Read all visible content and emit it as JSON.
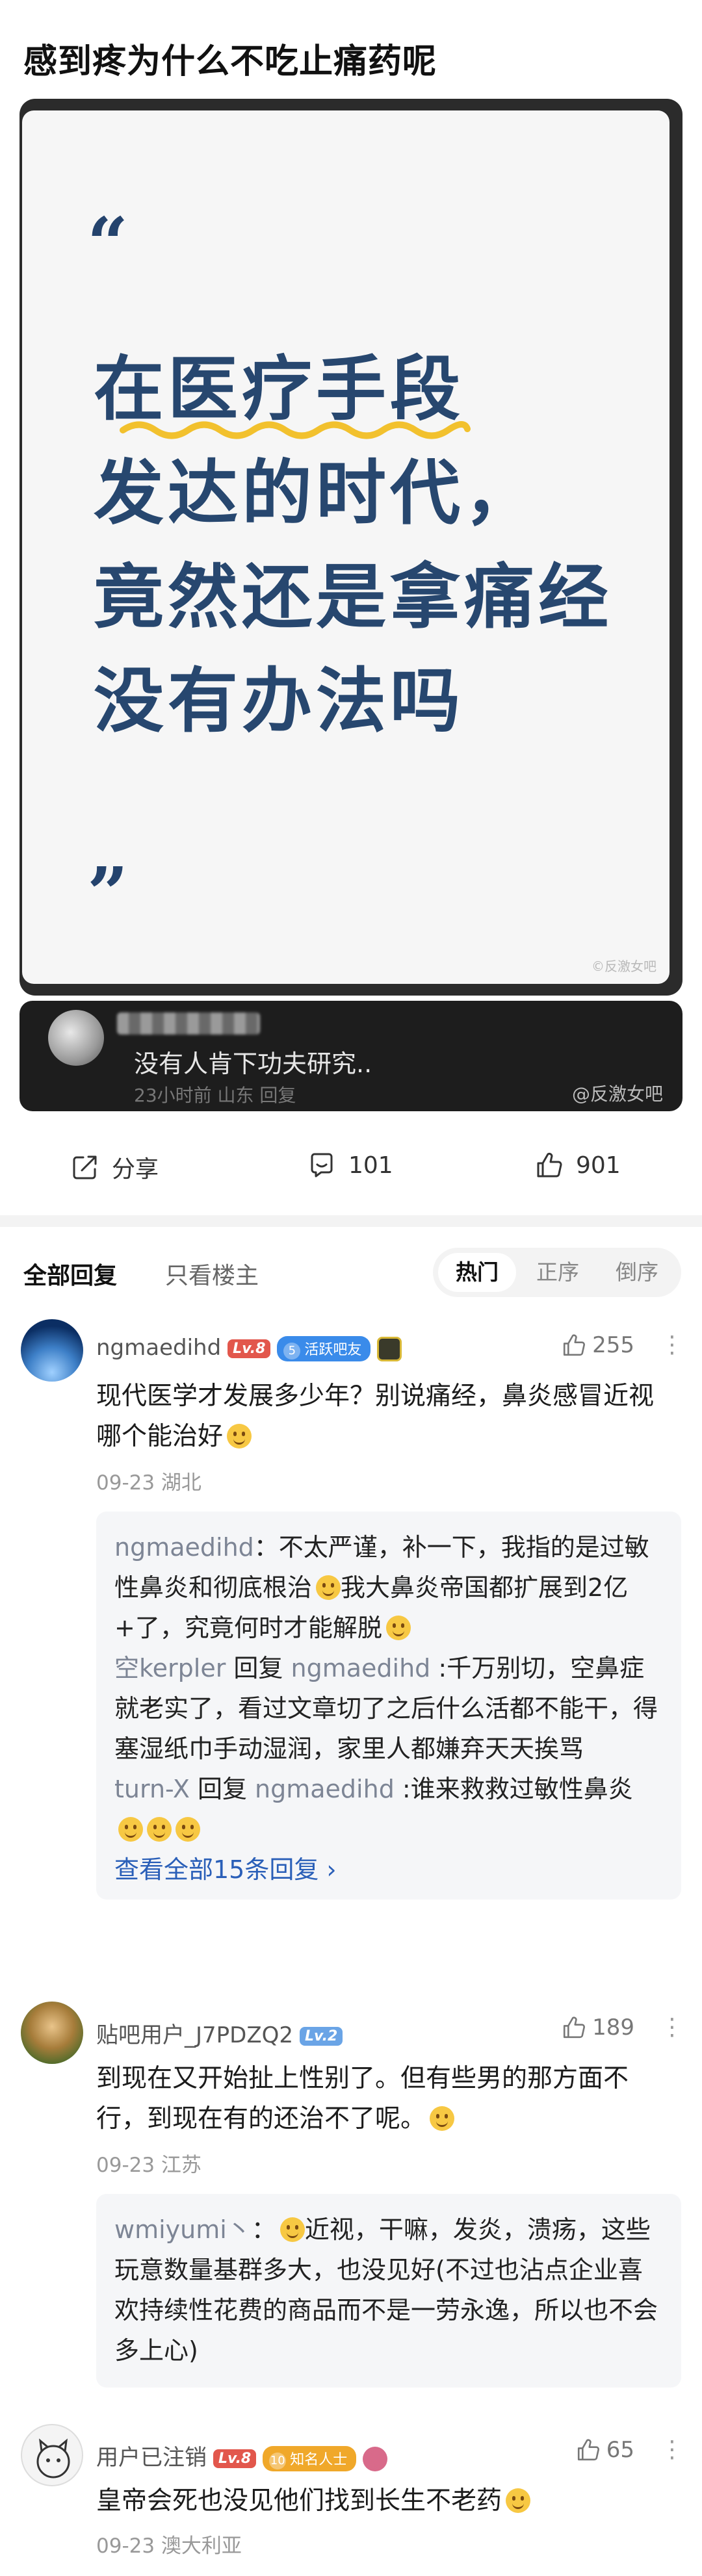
{
  "post": {
    "title": "感到疼为什么不吃止痛药呢",
    "image": {
      "quote_open": "“",
      "quote_close": "”",
      "lines": [
        "在医疗手段",
        "发达的时代，",
        "竟然还是拿痛经",
        "没有办法吗"
      ],
      "watermark": "©反激女吧"
    },
    "quoted_comment": {
      "text": "没有人肯下功夫研究..",
      "meta": "23小时前  山东  回复",
      "watermark": "@反激女吧"
    }
  },
  "actions": {
    "share_label": "分享",
    "comments_count": "101",
    "likes_count": "901"
  },
  "tabs": {
    "all_replies": "全部回复",
    "only_op": "只看楼主",
    "sort_options": [
      "热门",
      "正序",
      "倒序"
    ],
    "active_sort": "热门"
  },
  "comments": [
    {
      "username": "ngmaedihd",
      "level": "Lv.8",
      "badge_num": "5",
      "badge": "活跃吧友",
      "likes": "255",
      "text": "现代医学才发展多少年？别说痛经，鼻炎感冒近视哪个能治好",
      "meta": "09-23  湖北",
      "replies": [
        {
          "name": "ngmaedihd",
          "sep": "：",
          "text": "不太严谨，补一下，我指的是过敏性鼻炎和彻底根治",
          "text2": "我大鼻炎帝国都扩展到2亿+了，究竟何时才能解脱"
        },
        {
          "name": "空kerpler",
          "reply_word": " 回复 ",
          "target": "ngmaedihd",
          "sep": " :",
          "text": "千万别切，空鼻症就老实了，看过文章切了之后什么活都不能干，得塞湿纸巾手动湿润，家里人都嫌弃天天挨骂"
        },
        {
          "name": "turn-X",
          "reply_word": " 回复 ",
          "target": "ngmaedihd",
          "sep": " :",
          "text": "谁来救救过敏性鼻炎"
        }
      ],
      "view_all": "查看全部15条回复 ›"
    },
    {
      "username": "贴吧用户_J7PDZQ2",
      "level": "Lv.2",
      "likes": "189",
      "text": "到现在又开始扯上性别了。但有些男的那方面不行，到现在有的还治不了呢。",
      "meta": "09-23  江苏",
      "replies": [
        {
          "name": "wmiyumi丶",
          "sep": "：",
          "text": "近视，干嘛，发炎，溃疡，这些玩意数量基群多大，也没见好(不过也沾点企业喜欢持续性花费的商品而不是一劳永逸，所以也不会多上心)"
        }
      ]
    },
    {
      "username": "用户已注销",
      "level": "Lv.8",
      "badge_num": "10",
      "badge": "知名人士",
      "likes": "65",
      "text": "皇帝会死也没见他们找到长生不老药",
      "meta": "09-23  澳大利亚"
    }
  ],
  "colors": {
    "quote_text": "#27476f",
    "highlight_squiggle": "#f2c12e",
    "link_blue": "#2a5fb8",
    "level_red": "#e2574c"
  }
}
